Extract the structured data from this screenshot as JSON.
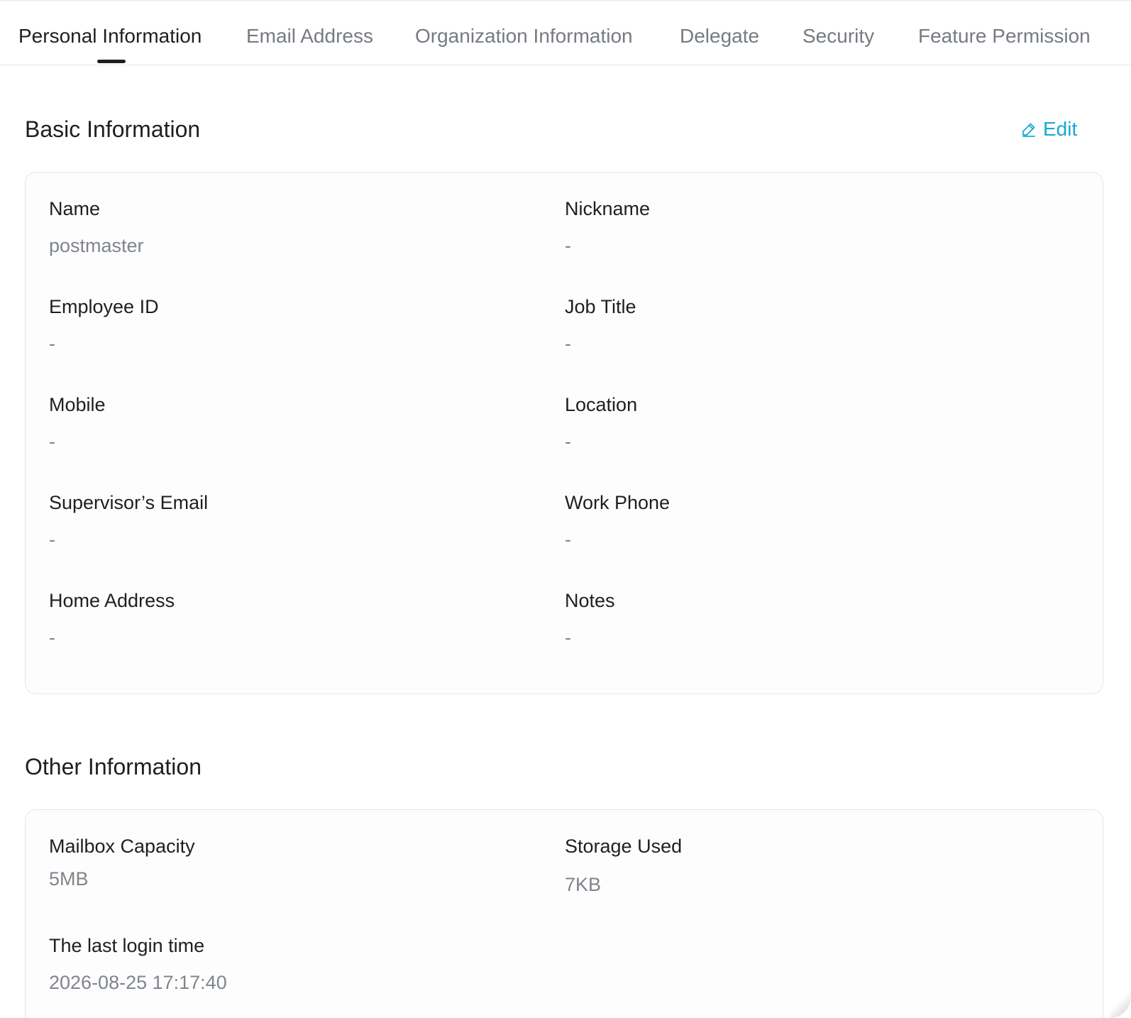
{
  "tabs": [
    {
      "label": "Personal Information",
      "active": true
    },
    {
      "label": "Email Address",
      "active": false
    },
    {
      "label": "Organization Information",
      "active": false
    },
    {
      "label": "Delegate",
      "active": false
    },
    {
      "label": "Security",
      "active": false
    },
    {
      "label": "Feature Permission",
      "active": false
    }
  ],
  "basic": {
    "title": "Basic Information",
    "edit_label": "Edit",
    "fields": {
      "name": {
        "label": "Name",
        "value": "postmaster"
      },
      "nickname": {
        "label": "Nickname",
        "value": "-"
      },
      "employee_id": {
        "label": "Employee ID",
        "value": "-"
      },
      "job_title": {
        "label": "Job Title",
        "value": "-"
      },
      "mobile": {
        "label": "Mobile",
        "value": "-"
      },
      "location": {
        "label": "Location",
        "value": "-"
      },
      "supervisor_email": {
        "label": "Supervisor’s Email",
        "value": "-"
      },
      "work_phone": {
        "label": "Work Phone",
        "value": "-"
      },
      "home_address": {
        "label": "Home Address",
        "value": "-"
      },
      "notes": {
        "label": "Notes",
        "value": "-"
      }
    }
  },
  "other": {
    "title": "Other Information",
    "fields": {
      "mailbox_capacity": {
        "label": "Mailbox Capacity",
        "value": "5MB"
      },
      "storage_used": {
        "label": "Storage Used",
        "value": "7KB"
      },
      "last_login": {
        "label": "The last login time",
        "value": "2026-08-25 17:17:40"
      }
    }
  },
  "colors": {
    "accent": "#16a8d4",
    "text_primary": "#1f1f1f",
    "text_secondary": "#80858c"
  },
  "icons": {
    "edit": "pencil-icon"
  }
}
